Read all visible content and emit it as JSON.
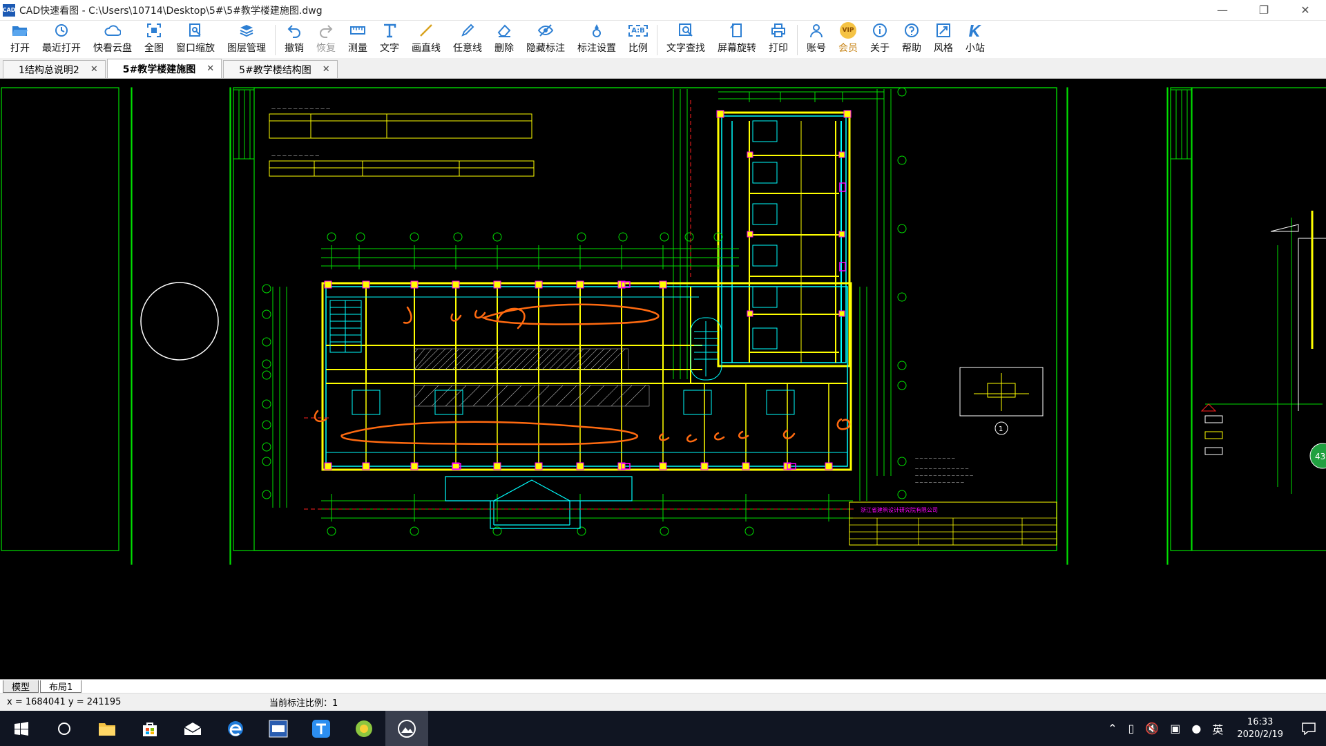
{
  "window": {
    "title": "CAD快速看图 - C:\\Users\\10714\\Desktop\\5#\\5#教学楼建施图.dwg",
    "app_icon_text": "CAD"
  },
  "toolbar": {
    "items": [
      {
        "label": "打开",
        "icon": "folder-open-icon"
      },
      {
        "label": "最近打开",
        "icon": "recent-clock-icon"
      },
      {
        "label": "快看云盘",
        "icon": "cloud-icon"
      },
      {
        "label": "全图",
        "icon": "fit-all-icon"
      },
      {
        "label": "窗口缩放",
        "icon": "window-zoom-icon"
      },
      {
        "label": "图层管理",
        "icon": "layers-icon"
      },
      {
        "label": "撤销",
        "icon": "undo-icon"
      },
      {
        "label": "恢复",
        "icon": "redo-icon"
      },
      {
        "label": "测量",
        "icon": "measure-icon"
      },
      {
        "label": "文字",
        "icon": "text-icon"
      },
      {
        "label": "画直线",
        "icon": "line-icon"
      },
      {
        "label": "任意线",
        "icon": "pencil-icon"
      },
      {
        "label": "删除",
        "icon": "eraser-icon"
      },
      {
        "label": "隐藏标注",
        "icon": "eye-hidden-icon"
      },
      {
        "label": "标注设置",
        "icon": "annotation-settings-icon"
      },
      {
        "label": "比例",
        "icon": "scale-icon"
      },
      {
        "label": "文字查找",
        "icon": "text-search-icon"
      },
      {
        "label": "屏幕旋转",
        "icon": "rotate-screen-icon"
      },
      {
        "label": "打印",
        "icon": "printer-icon"
      },
      {
        "label": "账号",
        "icon": "user-icon"
      },
      {
        "label": "会员",
        "icon": "vip-icon"
      },
      {
        "label": "关于",
        "icon": "info-icon"
      },
      {
        "label": "帮助",
        "icon": "help-icon"
      },
      {
        "label": "风格",
        "icon": "style-icon"
      },
      {
        "label": "小站",
        "icon": "station-icon"
      }
    ],
    "vip_badge": "VIP",
    "scale_badge": "A:B"
  },
  "tabs": [
    {
      "label": "1结构总说明2",
      "active": false
    },
    {
      "label": "5#教学楼建施图",
      "active": true
    },
    {
      "label": "5#教学楼结构图",
      "active": false
    }
  ],
  "tab_close": "✕",
  "layout_tabs": [
    {
      "label": "模型",
      "active": true
    },
    {
      "label": "布局1",
      "active": false
    }
  ],
  "status": {
    "coords": "x = 1684041  y = 241195",
    "scale": "当前标注比例：1"
  },
  "drawing": {
    "company": "浙江省建筑设计研究院有限公司",
    "detail_number": "1",
    "side_badge": "43"
  },
  "taskbar": {
    "ime": "英",
    "time": "16:33",
    "date": "2020/2/19"
  },
  "colors": {
    "green": "#00ff00",
    "yellow": "#ffff00",
    "cyan": "#00ffff",
    "magenta": "#ff00ff",
    "red": "#ff2020",
    "orange": "#ff6a10"
  }
}
